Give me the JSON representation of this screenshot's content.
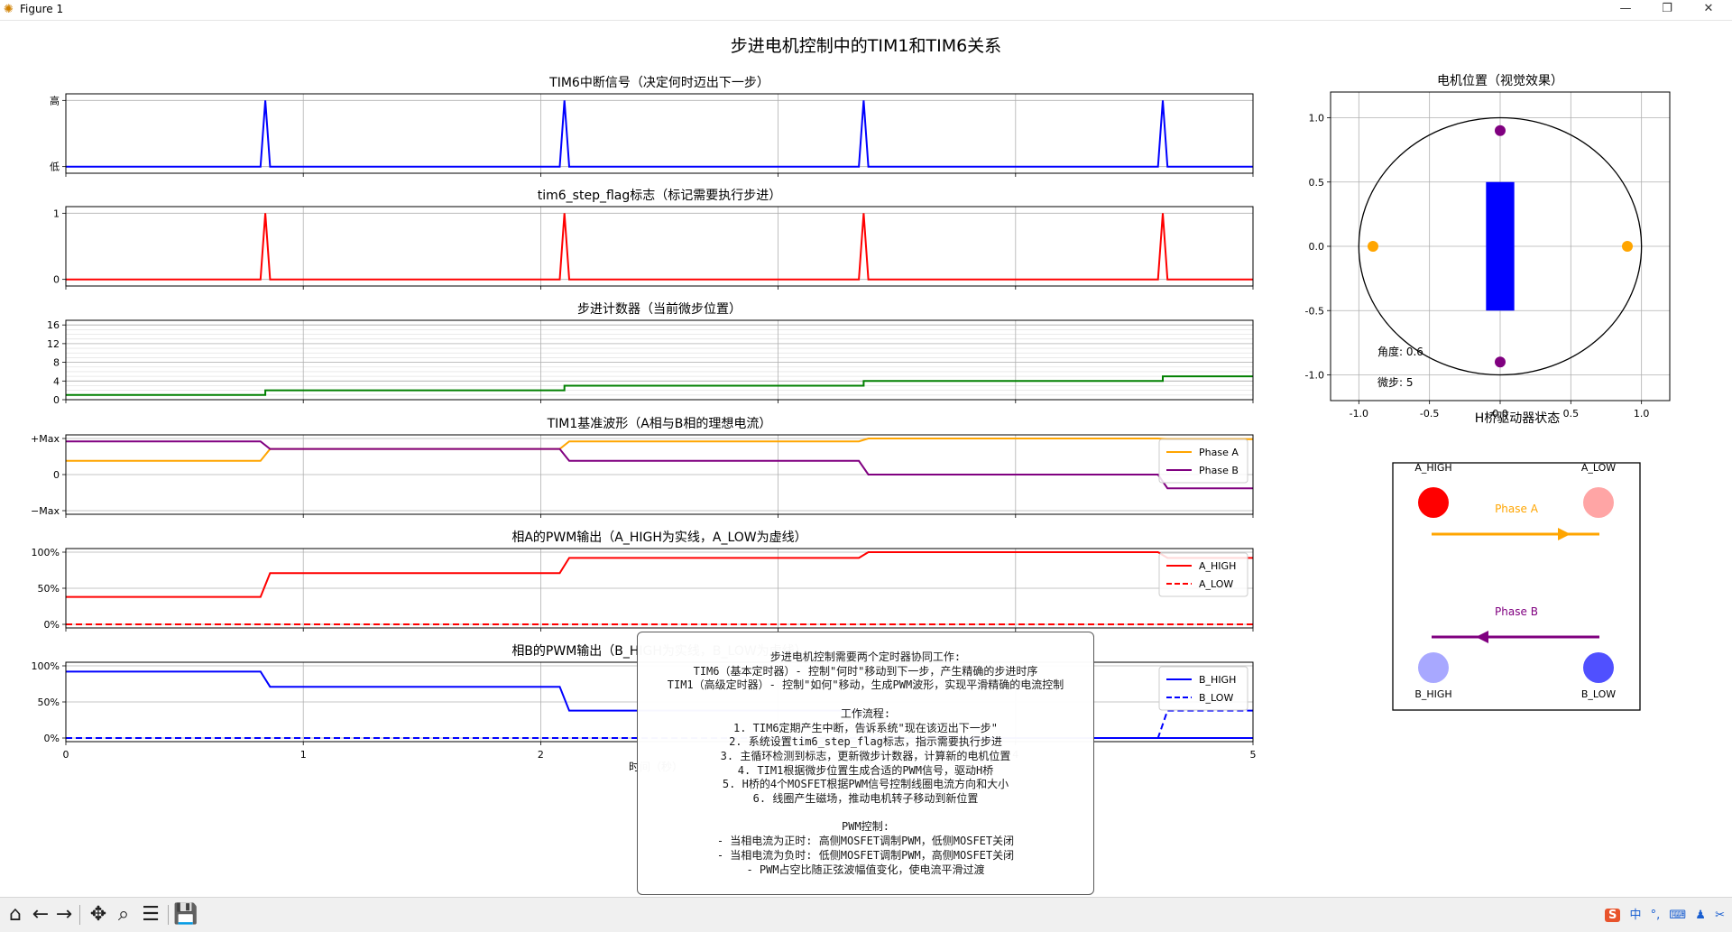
{
  "window": {
    "title": "Figure 1",
    "minimize": "—",
    "maximize": "❐",
    "close": "✕"
  },
  "figure_title": "步进电机控制中的TIM1和TIM6关系",
  "colors": {
    "blue": "#0000ff",
    "red": "#ff0000",
    "green": "#008000",
    "orange": "#ffa500",
    "purple": "#800080",
    "grid": "#b0b0b0"
  },
  "chart_data": [
    {
      "type": "line",
      "title": "TIM6中断信号（决定何时迈出下一步）",
      "xlim": [
        0,
        5
      ],
      "ylim": [
        -0.1,
        1.1
      ],
      "yticks": [
        {
          "v": 0,
          "label": "低"
        },
        {
          "v": 1,
          "label": "高"
        }
      ],
      "series": [
        {
          "color": "#0000ff",
          "style": "solid",
          "x": [
            0,
            0.82,
            0.84,
            0.86,
            2.08,
            2.1,
            2.12,
            3.34,
            3.36,
            3.38,
            4.6,
            4.62,
            4.64,
            5
          ],
          "y": [
            0,
            0,
            1,
            0,
            0,
            1,
            0,
            0,
            1,
            0,
            0,
            1,
            0,
            0
          ]
        }
      ]
    },
    {
      "type": "line",
      "title": "tim6_step_flag标志（标记需要执行步进）",
      "xlim": [
        0,
        5
      ],
      "ylim": [
        -0.1,
        1.1
      ],
      "yticks": [
        {
          "v": 0,
          "label": "0"
        },
        {
          "v": 1,
          "label": "1"
        }
      ],
      "series": [
        {
          "color": "#ff0000",
          "style": "solid",
          "x": [
            0,
            0.82,
            0.84,
            0.86,
            2.08,
            2.1,
            2.12,
            3.34,
            3.36,
            3.38,
            4.6,
            4.62,
            4.64,
            5
          ],
          "y": [
            0,
            0,
            1,
            0,
            0,
            1,
            0,
            0,
            1,
            0,
            0,
            1,
            0,
            0
          ]
        }
      ]
    },
    {
      "type": "line",
      "title": "步进计数器（当前微步位置）",
      "xlim": [
        0,
        5
      ],
      "ylim": [
        0,
        17
      ],
      "grid_minor": true,
      "yticks": [
        {
          "v": 0,
          "label": "0"
        },
        {
          "v": 4,
          "label": "4"
        },
        {
          "v": 8,
          "label": "8"
        },
        {
          "v": 12,
          "label": "12"
        },
        {
          "v": 16,
          "label": "16"
        }
      ],
      "series": [
        {
          "color": "#008000",
          "style": "solid",
          "x": [
            0,
            0.84,
            0.84,
            2.1,
            2.1,
            3.36,
            3.36,
            4.62,
            4.62,
            5
          ],
          "y": [
            1,
            1,
            2,
            2,
            3,
            3,
            4,
            4,
            5,
            5
          ]
        }
      ]
    },
    {
      "type": "line",
      "title": "TIM1基准波形（A相与B相的理想电流）",
      "xlim": [
        0,
        5
      ],
      "ylim": [
        -1.1,
        1.1
      ],
      "yticks": [
        {
          "v": -1,
          "label": "−Max"
        },
        {
          "v": 0,
          "label": "0"
        },
        {
          "v": 1,
          "label": "+Max"
        }
      ],
      "legend": [
        {
          "name": "Phase A",
          "color": "#ffa500",
          "style": "solid"
        },
        {
          "name": "Phase B",
          "color": "#800080",
          "style": "solid"
        }
      ],
      "series": [
        {
          "color": "#ffa500",
          "style": "solid",
          "x": [
            0,
            0.82,
            0.86,
            2.08,
            2.12,
            3.34,
            3.38,
            4.6,
            4.64,
            5
          ],
          "y": [
            0.38,
            0.38,
            0.71,
            0.71,
            0.92,
            0.92,
            1.0,
            1.0,
            0.98,
            0.98
          ]
        },
        {
          "color": "#800080",
          "style": "solid",
          "x": [
            0,
            0.82,
            0.86,
            2.08,
            2.12,
            3.34,
            3.38,
            4.6,
            4.64,
            5
          ],
          "y": [
            0.92,
            0.92,
            0.71,
            0.71,
            0.38,
            0.38,
            0.0,
            0.0,
            -0.38,
            -0.38
          ]
        }
      ]
    },
    {
      "type": "line",
      "title": "相A的PWM输出（A_HIGH为实线，A_LOW为虚线）",
      "xlim": [
        0,
        5
      ],
      "ylim": [
        -0.05,
        1.05
      ],
      "yticks": [
        {
          "v": 0,
          "label": "0%"
        },
        {
          "v": 0.5,
          "label": "50%"
        },
        {
          "v": 1,
          "label": "100%"
        }
      ],
      "legend": [
        {
          "name": "A_HIGH",
          "color": "#ff0000",
          "style": "solid"
        },
        {
          "name": "A_LOW",
          "color": "#ff0000",
          "style": "dashed"
        }
      ],
      "series": [
        {
          "color": "#ff0000",
          "style": "solid",
          "x": [
            0,
            0.82,
            0.86,
            2.08,
            2.12,
            3.34,
            3.38,
            4.6,
            4.64,
            5
          ],
          "y": [
            0.38,
            0.38,
            0.71,
            0.71,
            0.92,
            0.92,
            1.0,
            1.0,
            0.92,
            0.92
          ]
        },
        {
          "color": "#ff0000",
          "style": "dashed",
          "x": [
            0,
            5
          ],
          "y": [
            0,
            0
          ]
        }
      ]
    },
    {
      "type": "line",
      "title": "相B的PWM输出（B_HIGH为实线，B_LOW为虚线）",
      "xlim": [
        0,
        5
      ],
      "ylim": [
        -0.05,
        1.05
      ],
      "xlabel": "时间（秒）",
      "xticks": [
        0,
        1,
        2,
        3,
        4,
        5
      ],
      "yticks": [
        {
          "v": 0,
          "label": "0%"
        },
        {
          "v": 0.5,
          "label": "50%"
        },
        {
          "v": 1,
          "label": "100%"
        }
      ],
      "legend": [
        {
          "name": "B_HIGH",
          "color": "#0000ff",
          "style": "solid"
        },
        {
          "name": "B_LOW",
          "color": "#0000ff",
          "style": "dashed"
        }
      ],
      "series": [
        {
          "color": "#0000ff",
          "style": "solid",
          "x": [
            0,
            0.82,
            0.86,
            2.08,
            2.12,
            3.34,
            3.38,
            4.6,
            4.64,
            5
          ],
          "y": [
            0.92,
            0.92,
            0.71,
            0.71,
            0.38,
            0.38,
            0.0,
            0.0,
            0.0,
            0.0
          ]
        },
        {
          "color": "#0000ff",
          "style": "dashed",
          "x": [
            0,
            4.6,
            4.64,
            5
          ],
          "y": [
            0,
            0,
            0.38,
            0.38
          ]
        }
      ]
    },
    {
      "type": "scatter",
      "title": "电机位置（视觉效果）",
      "xlim": [
        -1.2,
        1.2
      ],
      "ylim": [
        -1.2,
        1.2
      ],
      "xticks": [
        -1.0,
        -0.5,
        0.0,
        0.5,
        1.0
      ],
      "yticks": [
        -1.0,
        -0.5,
        0.0,
        0.5,
        1.0
      ],
      "circle_radius": 1.0,
      "rotor": {
        "x0": -0.1,
        "x1": 0.1,
        "y0": -0.5,
        "y1": 0.5,
        "color": "#0000ff"
      },
      "points": [
        {
          "x": 0,
          "y": 0.9,
          "color": "#800080"
        },
        {
          "x": 0,
          "y": -0.9,
          "color": "#800080"
        },
        {
          "x": -0.9,
          "y": 0,
          "color": "#ffa500"
        },
        {
          "x": 0.9,
          "y": 0,
          "color": "#ffa500"
        }
      ],
      "annotations": [
        "角度: 0.6",
        "微步: 5"
      ]
    }
  ],
  "hbridge": {
    "title": "H桥驱动器状态",
    "a_high": "A_HIGH",
    "a_low": "A_LOW",
    "b_high": "B_HIGH",
    "b_low": "B_LOW",
    "phase_a": "Phase A",
    "phase_b": "Phase B",
    "a_high_color": "#ff0000",
    "a_low_color": "#ffa5a5",
    "b_high_color": "#a8a8ff",
    "b_low_color": "#5050ff"
  },
  "info_text": "步进电机控制需要两个定时器协同工作:\nTIM6（基本定时器）- 控制\"何时\"移动到下一步，产生精确的步进时序\nTIM1（高级定时器）- 控制\"如何\"移动，生成PWM波形，实现平滑精确的电流控制\n\n工作流程:\n1. TIM6定期产生中断，告诉系统\"现在该迈出下一步\"\n2. 系统设置tim6_step_flag标志，指示需要执行步进\n3. 主循环检测到标志，更新微步计数器，计算新的电机位置\n4. TIM1根据微步位置生成合适的PWM信号，驱动H桥\n5. H桥的4个MOSFET根据PWM信号控制线圈电流方向和大小\n6. 线圈产生磁场，推动电机转子移动到新位置\n\nPWM控制:\n- 当相电流为正时: 高侧MOSFET调制PWM，低侧MOSFET关闭\n- 当相电流为负时: 低侧MOSFET调制PWM，高侧MOSFET关闭\n- PWM占空比随正弦波幅值变化，使电流平滑过渡",
  "tray": [
    "中",
    "°,",
    "⌨",
    "♟",
    "✂"
  ]
}
